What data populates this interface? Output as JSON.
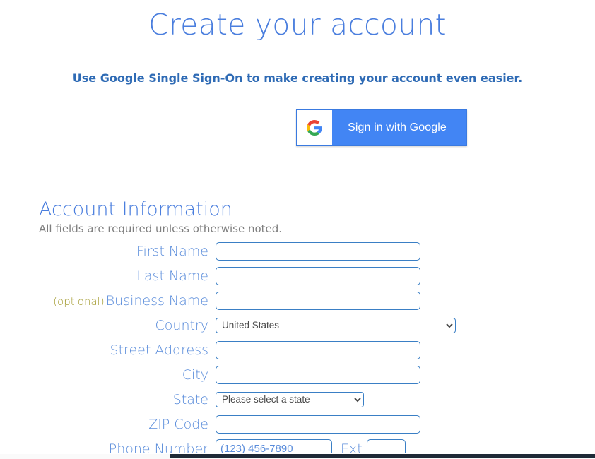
{
  "page": {
    "title": "Create your account",
    "title_color": "#4a7ede"
  },
  "sso": {
    "subtitle": "Use Google Single Sign-On to make creating your account even easier.",
    "button_label": "Sign in with Google",
    "button_color": "#4285f4",
    "icon": "google-g-icon"
  },
  "account_section": {
    "heading": "Account Information",
    "note": "All fields are required unless otherwise noted.",
    "fields": [
      {
        "id": "first-name",
        "label": "First Name",
        "optional_tag": "",
        "control": "text",
        "value": "",
        "placeholder": ""
      },
      {
        "id": "last-name",
        "label": "Last Name",
        "optional_tag": "",
        "control": "text",
        "value": "",
        "placeholder": ""
      },
      {
        "id": "business-name",
        "label": "Business Name",
        "optional_tag": "(optional)",
        "control": "text",
        "value": "",
        "placeholder": ""
      },
      {
        "id": "country",
        "label": "Country",
        "optional_tag": "",
        "control": "select",
        "value": "United States",
        "placeholder": ""
      },
      {
        "id": "street-address",
        "label": "Street Address",
        "optional_tag": "",
        "control": "text",
        "value": "",
        "placeholder": ""
      },
      {
        "id": "city",
        "label": "City",
        "optional_tag": "",
        "control": "text",
        "value": "",
        "placeholder": ""
      },
      {
        "id": "state",
        "label": "State",
        "optional_tag": "",
        "control": "select",
        "value": "Please select a state",
        "placeholder": ""
      },
      {
        "id": "zip-code",
        "label": "ZIP Code",
        "optional_tag": "",
        "control": "text",
        "value": "",
        "placeholder": ""
      },
      {
        "id": "phone-number",
        "label": "Phone Number",
        "optional_tag": "",
        "control": "phone",
        "value": "",
        "placeholder": "(123) 456-7890"
      }
    ],
    "ext_label": "Ext",
    "ext_value": "",
    "optional_color": "#a39a2e",
    "label_color": "#5b8ddb",
    "input_border_color": "#3a7fc5"
  }
}
